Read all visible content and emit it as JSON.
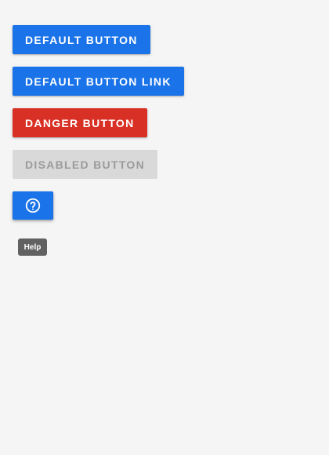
{
  "buttons": {
    "default_label": "Default Button",
    "link_label": "Default Button Link",
    "danger_label": "Danger Button",
    "disabled_label": "Disabled Button"
  },
  "help": {
    "icon": "help-circle-icon",
    "tooltip": "Help"
  },
  "colors": {
    "primary": "#1a73e8",
    "danger": "#d93025",
    "disabled_bg": "#d9d9d9",
    "disabled_text": "#9b9b9b",
    "tooltip_bg": "#616161",
    "background": "#f5f5f5"
  }
}
